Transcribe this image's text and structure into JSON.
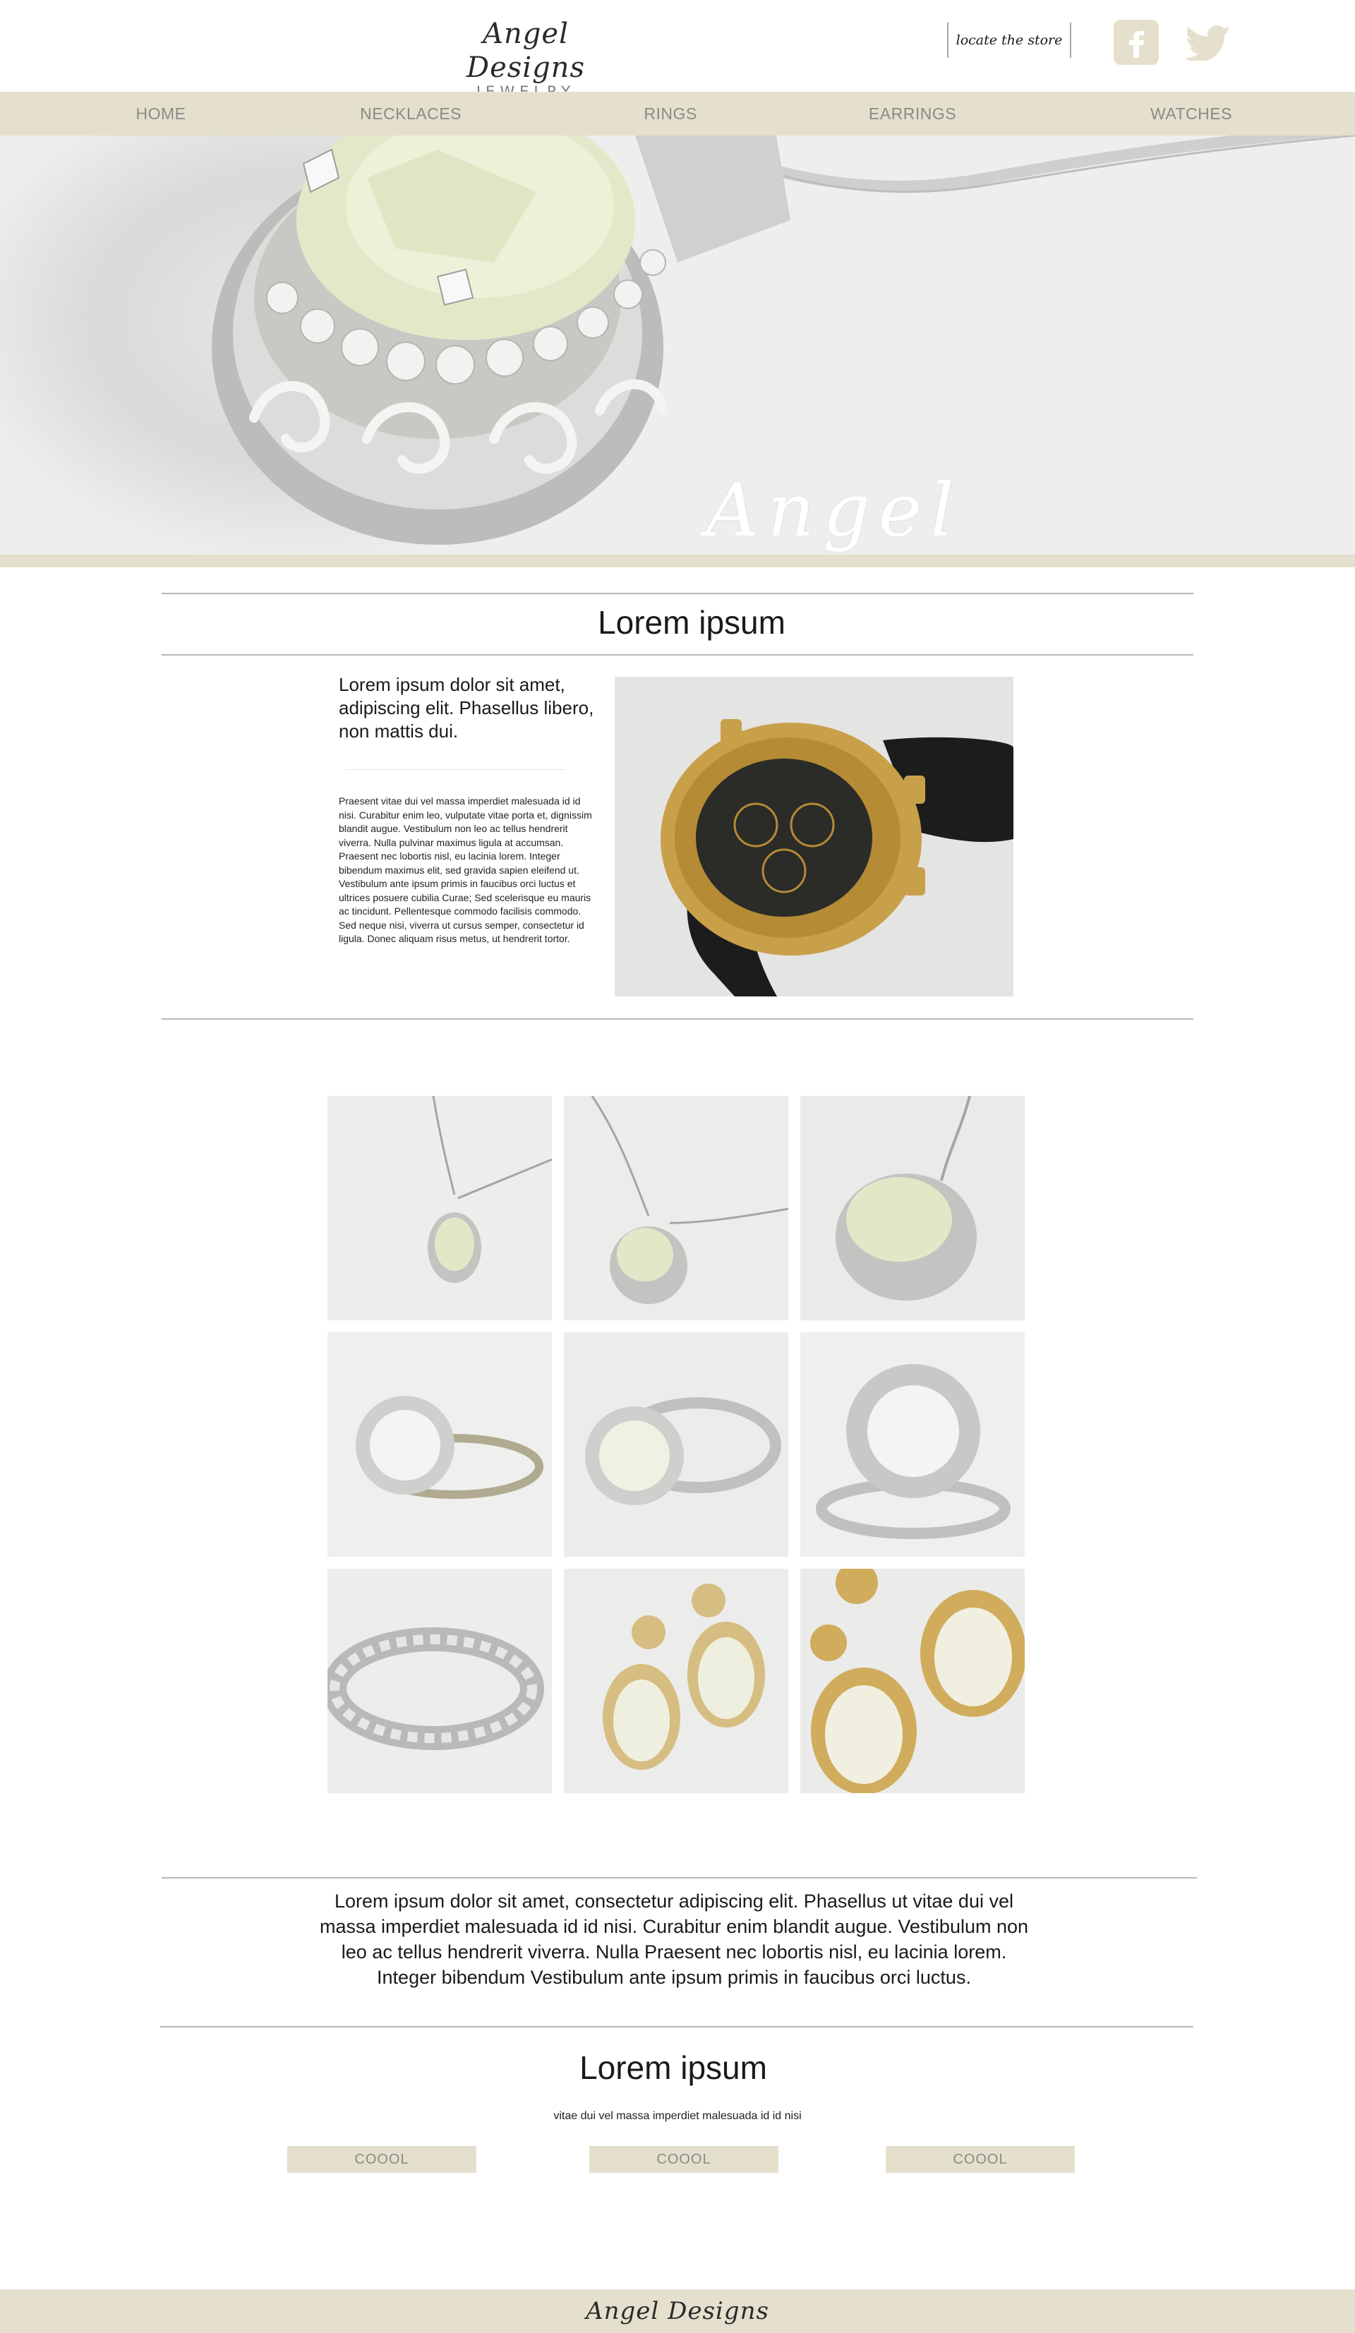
{
  "brand": {
    "logo_script": "Angel Designs",
    "logo_sub": "JEWELRY",
    "hero_script": "Angel Designs",
    "footer_script": "Angel Designs"
  },
  "header": {
    "locate_label": "locate the store",
    "social_icons": [
      "facebook-icon",
      "twitter-icon"
    ]
  },
  "nav": {
    "items": [
      {
        "label": "HOME"
      },
      {
        "label": "NECKLACES"
      },
      {
        "label": "RINGS"
      },
      {
        "label": "EARRINGS"
      },
      {
        "label": "WATCHES"
      }
    ]
  },
  "intro": {
    "title": "Lorem ipsum",
    "lead": "Lorem ipsum dolor sit amet, adipiscing elit. Phasellus  libero, non mattis dui.",
    "body": "Praesent vitae dui vel massa imperdiet malesuada id id nisi. Curabitur enim leo, vulputate vitae porta et, dignissim blandit augue. Vestibulum non leo ac tellus hendrerit viverra. Nulla pulvinar maximus ligula at accumsan. Praesent nec lobortis nisl, eu lacinia lorem. Integer bibendum maximus elit, sed gravida sapien eleifend ut. Vestibulum ante ipsum primis in faucibus orci luctus et ultrices posuere cubilia Curae; Sed scelerisque eu mauris ac tincidunt. Pellentesque commodo facilisis commodo. Sed neque nisi, viverra ut cursus semper, consectetur id ligula. Donec aliquam risus metus, ut hendrerit tortor."
  },
  "gallery": {
    "items": [
      "pendant-necklace-1",
      "pendant-necklace-2",
      "pendant-closeup",
      "diamond-ring-1",
      "diamond-ring-2",
      "diamond-ring-3",
      "eternity-band",
      "drop-earrings-1",
      "drop-earrings-2"
    ]
  },
  "feature": {
    "paragraph": "Lorem ipsum dolor sit amet, consectetur adipiscing elit. Phasellus ut vitae dui vel massa imperdiet malesuada id id nisi. Curabitur enim blandit augue. Vestibulum non leo ac tellus hendrerit viverra. Nulla Praesent nec lobortis nisl, eu lacinia lorem. Integer bibendum Vestibulum ante ipsum primis in faucibus orci luctus.",
    "title": "Lorem ipsum",
    "subtitle": "vitae dui vel massa imperdiet malesuada id id nisi",
    "buttons": [
      {
        "label": "COOOL"
      },
      {
        "label": "COOOL"
      },
      {
        "label": "COOOL"
      }
    ]
  },
  "colors": {
    "band": "#e4e0cd",
    "nav_text": "#8b8b85",
    "rule": "#b8b8b8"
  }
}
